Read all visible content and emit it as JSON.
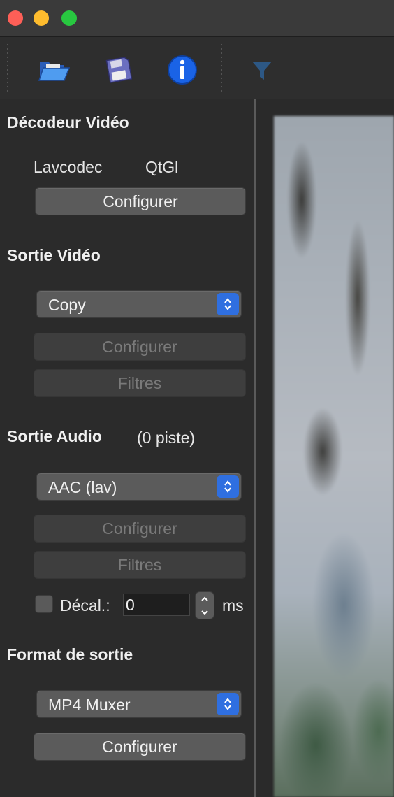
{
  "toolbar": {
    "open_icon": "folder-open-icon",
    "save_icon": "floppy-disk-icon",
    "info_icon": "info-icon",
    "filter_icon": "funnel-filter-icon"
  },
  "video_decoder": {
    "heading": "Décodeur Vidéo",
    "decoder_name": "Lavcodec",
    "renderer_name": "QtGl",
    "configure_label": "Configurer"
  },
  "video_output": {
    "heading": "Sortie Vidéo",
    "selected": "Copy",
    "configure_label": "Configurer",
    "filters_label": "Filtres"
  },
  "audio_output": {
    "heading": "Sortie Audio",
    "track_count": "(0 piste)",
    "selected": "AAC (lav)",
    "configure_label": "Configurer",
    "filters_label": "Filtres",
    "shift_label": "Décal.:",
    "shift_value": "0",
    "shift_unit": "ms"
  },
  "output_format": {
    "heading": "Format de sortie",
    "selected": "MP4 Muxer",
    "configure_label": "Configurer"
  },
  "colors": {
    "accent": "#2f6fe0",
    "close": "#fe5f57",
    "minimize": "#febc2e",
    "maximize": "#28c840"
  }
}
